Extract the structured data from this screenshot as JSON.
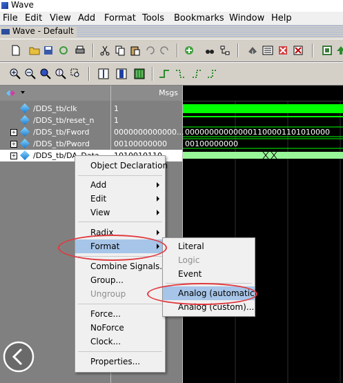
{
  "window": {
    "title": "Wave"
  },
  "menubar": {
    "items": [
      "File",
      "Edit",
      "View",
      "Add",
      "Format",
      "Tools",
      "Bookmarks",
      "Window",
      "Help"
    ]
  },
  "subwindow": {
    "title": "Wave - Default"
  },
  "header": {
    "msgs_label": "Msgs"
  },
  "signals": [
    {
      "name": "/DDS_tb/clk",
      "value": "1",
      "expandable": false
    },
    {
      "name": "/DDS_tb/reset_n",
      "value": "1",
      "expandable": false
    },
    {
      "name": "/DDS_tb/Fword",
      "value": "0000000000000...",
      "expandable": true
    },
    {
      "name": "/DDS_tb/Pword",
      "value": "00100000000",
      "expandable": true
    },
    {
      "name": "/DDS_tb/DA_Data",
      "value": "1010010110",
      "expandable": true
    }
  ],
  "wave_values": {
    "fword": "000000000000001100001101010000",
    "pword": "00100000000"
  },
  "context_menu": {
    "object_declaration": "Object Declaration",
    "add": "Add",
    "edit": "Edit",
    "view": "View",
    "radix": "Radix",
    "format": "Format",
    "combine_signals": "Combine Signals...",
    "group": "Group...",
    "ungroup": "Ungroup",
    "force": "Force...",
    "noforce": "NoForce",
    "clock": "Clock...",
    "properties": "Properties..."
  },
  "format_submenu": {
    "literal": "Literal",
    "logic": "Logic",
    "event": "Event",
    "analog_auto": "Analog (automatic)",
    "analog_custom": "Analog (custom)..."
  },
  "colors": {
    "wave_green": "#00ff00",
    "highlight": "#a7c5e8",
    "annotation": "#e0393f"
  }
}
